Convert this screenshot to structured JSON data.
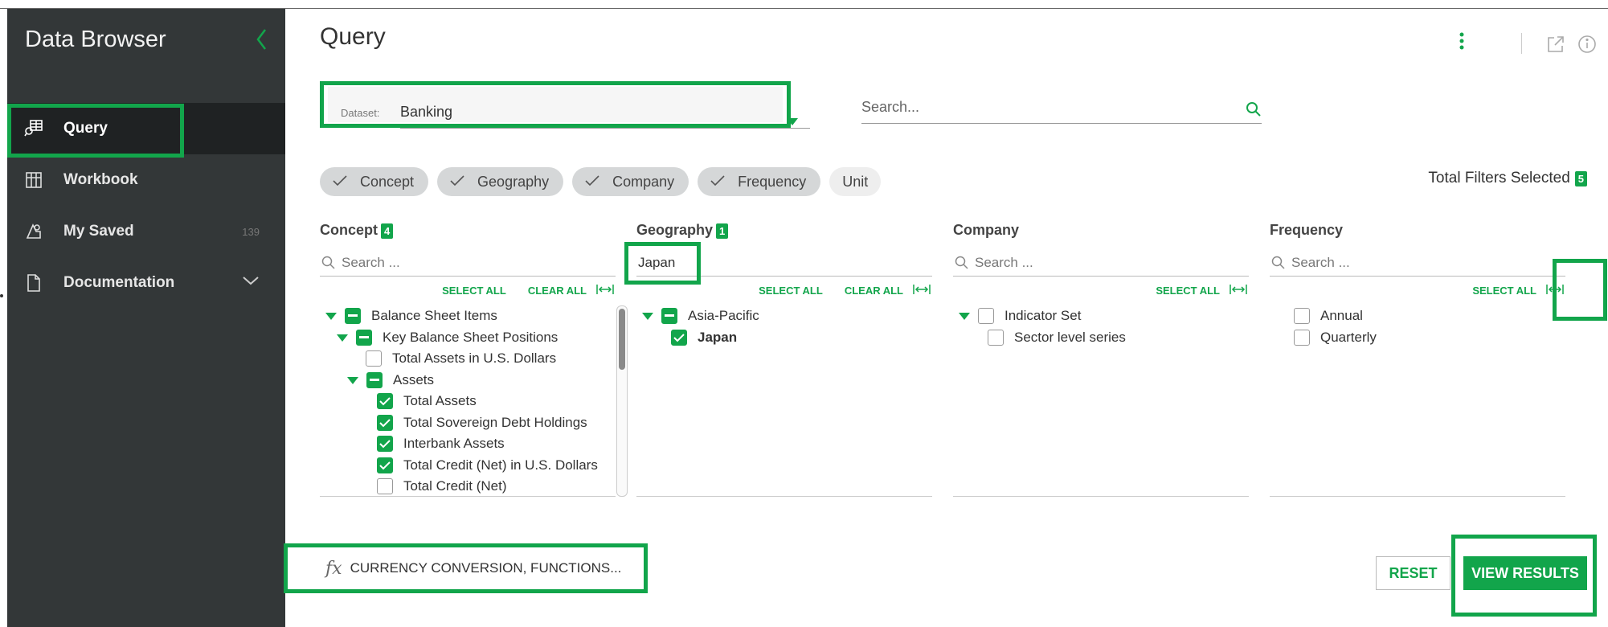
{
  "sidebar": {
    "title": "Data Browser",
    "items": [
      {
        "label": "Query",
        "icon": "query-icon"
      },
      {
        "label": "Workbook",
        "icon": "grid-icon"
      },
      {
        "label": "My Saved",
        "count": "139",
        "icon": "saved-icon"
      },
      {
        "label": "Documentation",
        "icon": "document-icon"
      }
    ]
  },
  "header": {
    "title": "Query"
  },
  "dataset": {
    "label": "Dataset:",
    "value": "Banking"
  },
  "search": {
    "placeholder": "Search..."
  },
  "chips": [
    {
      "label": "Concept",
      "checked": true
    },
    {
      "label": "Geography",
      "checked": true
    },
    {
      "label": "Company",
      "checked": true
    },
    {
      "label": "Frequency",
      "checked": true
    },
    {
      "label": "Unit",
      "checked": false
    }
  ],
  "total_filters": {
    "label": "Total Filters Selected",
    "count": "5"
  },
  "facets": {
    "concept": {
      "title": "Concept",
      "count": "4",
      "search_placeholder": "Search ...",
      "select_all": "SELECT ALL",
      "clear_all": "CLEAR ALL",
      "items": [
        "Balance Sheet Items",
        "Key Balance Sheet Positions",
        "Total Assets in U.S. Dollars",
        "Assets",
        "Total Assets",
        "Total Sovereign Debt Holdings",
        "Interbank Assets",
        "Total Credit (Net) in U.S. Dollars",
        "Total Credit (Net)"
      ]
    },
    "geography": {
      "title": "Geography",
      "count": "1",
      "search_value": "Japan",
      "select_all": "SELECT ALL",
      "clear_all": "CLEAR ALL",
      "items": [
        "Asia-Pacific",
        "Japan"
      ]
    },
    "company": {
      "title": "Company",
      "search_placeholder": "Search ...",
      "select_all": "SELECT ALL",
      "items": [
        "Indicator Set",
        "Sector level series"
      ]
    },
    "frequency": {
      "title": "Frequency",
      "search_placeholder": "Search ...",
      "select_all": "SELECT ALL",
      "items": [
        "Annual",
        "Quarterly"
      ]
    }
  },
  "functions_button": {
    "label": "CURRENCY CONVERSION, FUNCTIONS..."
  },
  "actions": {
    "reset": "RESET",
    "view_results": "VIEW RESULTS"
  },
  "colors": {
    "accent": "#12a54b",
    "sidebar": "#333738",
    "sidebar_active": "#1f2223"
  }
}
